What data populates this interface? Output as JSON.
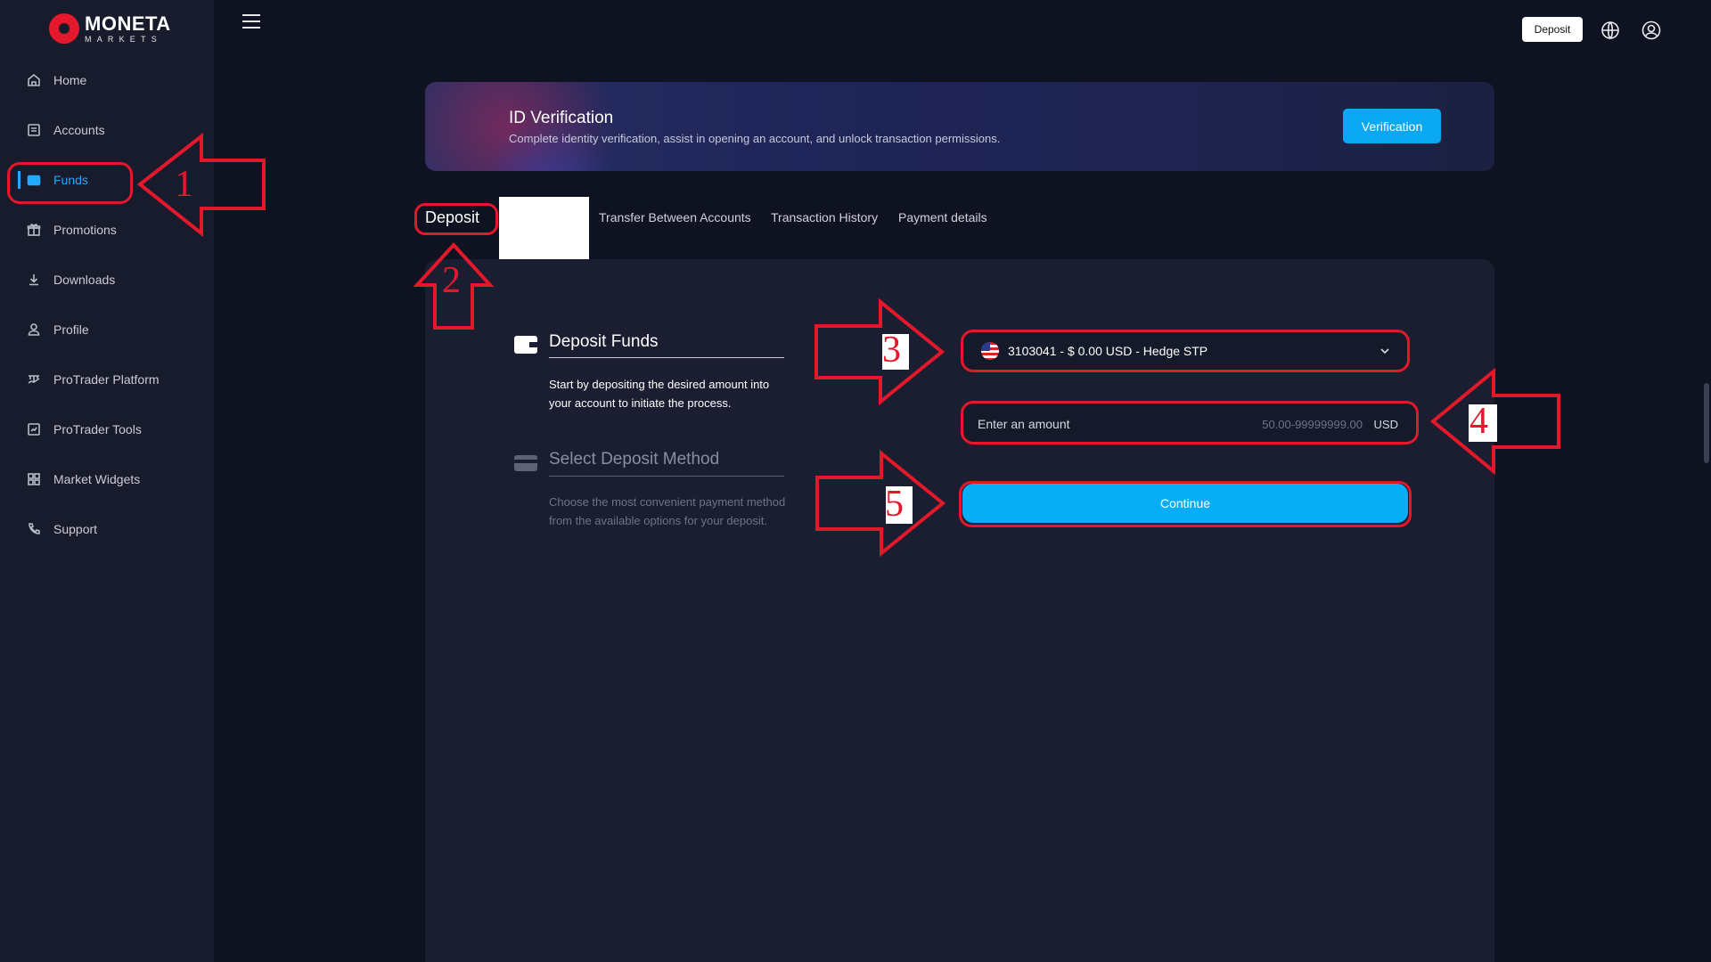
{
  "brand": {
    "name": "MONETA",
    "sub": "MARKETS"
  },
  "sidebar": {
    "items": [
      {
        "label": "Home",
        "icon": "home-icon"
      },
      {
        "label": "Accounts",
        "icon": "accounts-icon"
      },
      {
        "label": "Funds",
        "icon": "wallet-icon",
        "active": true
      },
      {
        "label": "Promotions",
        "icon": "gift-icon"
      },
      {
        "label": "Downloads",
        "icon": "download-icon"
      },
      {
        "label": "Profile",
        "icon": "user-icon"
      },
      {
        "label": "ProTrader Platform",
        "icon": "platform-icon"
      },
      {
        "label": "ProTrader Tools",
        "icon": "chart-icon"
      },
      {
        "label": "Market Widgets",
        "icon": "widgets-icon"
      },
      {
        "label": "Support",
        "icon": "phone-icon"
      }
    ]
  },
  "topbar": {
    "deposit_label": "Deposit",
    "icons": [
      "globe-icon",
      "user-avatar-icon"
    ]
  },
  "banner": {
    "title": "ID Verification",
    "description": "Complete identity verification, assist in opening an account, and unlock transaction permissions.",
    "button_label": "Verification"
  },
  "tabs": [
    {
      "label": "Deposit",
      "active": true
    },
    {
      "label": "Transfer Between Accounts"
    },
    {
      "label": "Transaction History"
    },
    {
      "label": "Payment details"
    }
  ],
  "steps": [
    {
      "title": "Deposit Funds",
      "description": "Start by depositing the desired amount into your account to initiate the process.",
      "active": true
    },
    {
      "title": "Select Deposit Method",
      "description": "Choose the most convenient payment method from the available options for your deposit.",
      "active": false
    }
  ],
  "form": {
    "account_value": "3103041 - $ 0.00 USD - Hedge STP",
    "amount_label": "Enter an amount",
    "amount_range": "50.00-99999999.00",
    "amount_currency": "USD",
    "continue_label": "Continue"
  },
  "annotations": [
    "1",
    "2",
    "3",
    "4",
    "5"
  ],
  "colors": {
    "accent": "#06aef6",
    "annotation": "#e3182a",
    "background": "#0f1321",
    "sidebar": "#171b2c"
  }
}
